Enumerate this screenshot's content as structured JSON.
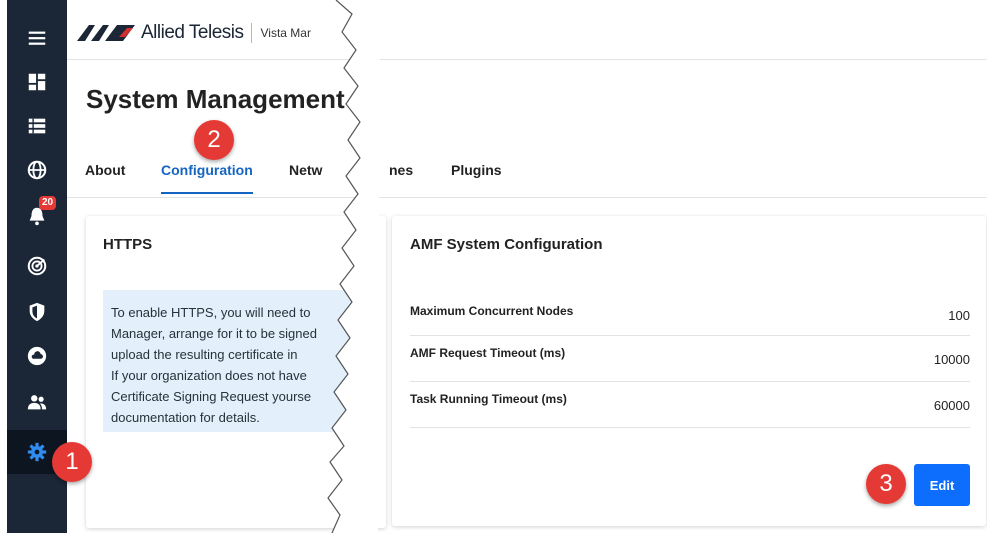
{
  "header": {
    "brand": "Allied Telesis",
    "product": "Vista Mar"
  },
  "page": {
    "title": "System Management"
  },
  "sidebar": {
    "items": [
      {
        "icon": "menu-icon"
      },
      {
        "icon": "dashboard-icon"
      },
      {
        "icon": "list-icon"
      },
      {
        "icon": "globe-icon"
      },
      {
        "icon": "bell-icon",
        "badge": "20"
      },
      {
        "icon": "radar-icon"
      },
      {
        "icon": "shield-icon"
      },
      {
        "icon": "cloud-icon"
      },
      {
        "icon": "users-icon"
      },
      {
        "icon": "gear-icon",
        "active": true
      }
    ]
  },
  "tabs": [
    {
      "label": "About"
    },
    {
      "label": "Configuration",
      "active": true
    },
    {
      "label": "Netw"
    },
    {
      "label": "nes"
    },
    {
      "label": "Plugins"
    }
  ],
  "https_card": {
    "title": "HTTPS",
    "info_lines": [
      "To enable HTTPS, you will need to",
      "Manager, arrange for it to be signed",
      "upload the resulting certificate in",
      "If your organization does not have",
      "Certificate Signing Request yourse",
      "documentation for details."
    ]
  },
  "amf_card": {
    "title": "AMF System Configuration",
    "rows": [
      {
        "label": "Maximum Concurrent Nodes",
        "value": "100"
      },
      {
        "label": "AMF Request Timeout (ms)",
        "value": "10000"
      },
      {
        "label": "Task Running Timeout (ms)",
        "value": "60000"
      }
    ],
    "edit_label": "Edit"
  },
  "callouts": [
    "1",
    "2",
    "3"
  ],
  "colors": {
    "sidebar_bg": "#1b2636",
    "accent": "#1565c0",
    "button": "#0d6efd",
    "callout": "#e53935",
    "info_bg": "#e3f0fb"
  }
}
